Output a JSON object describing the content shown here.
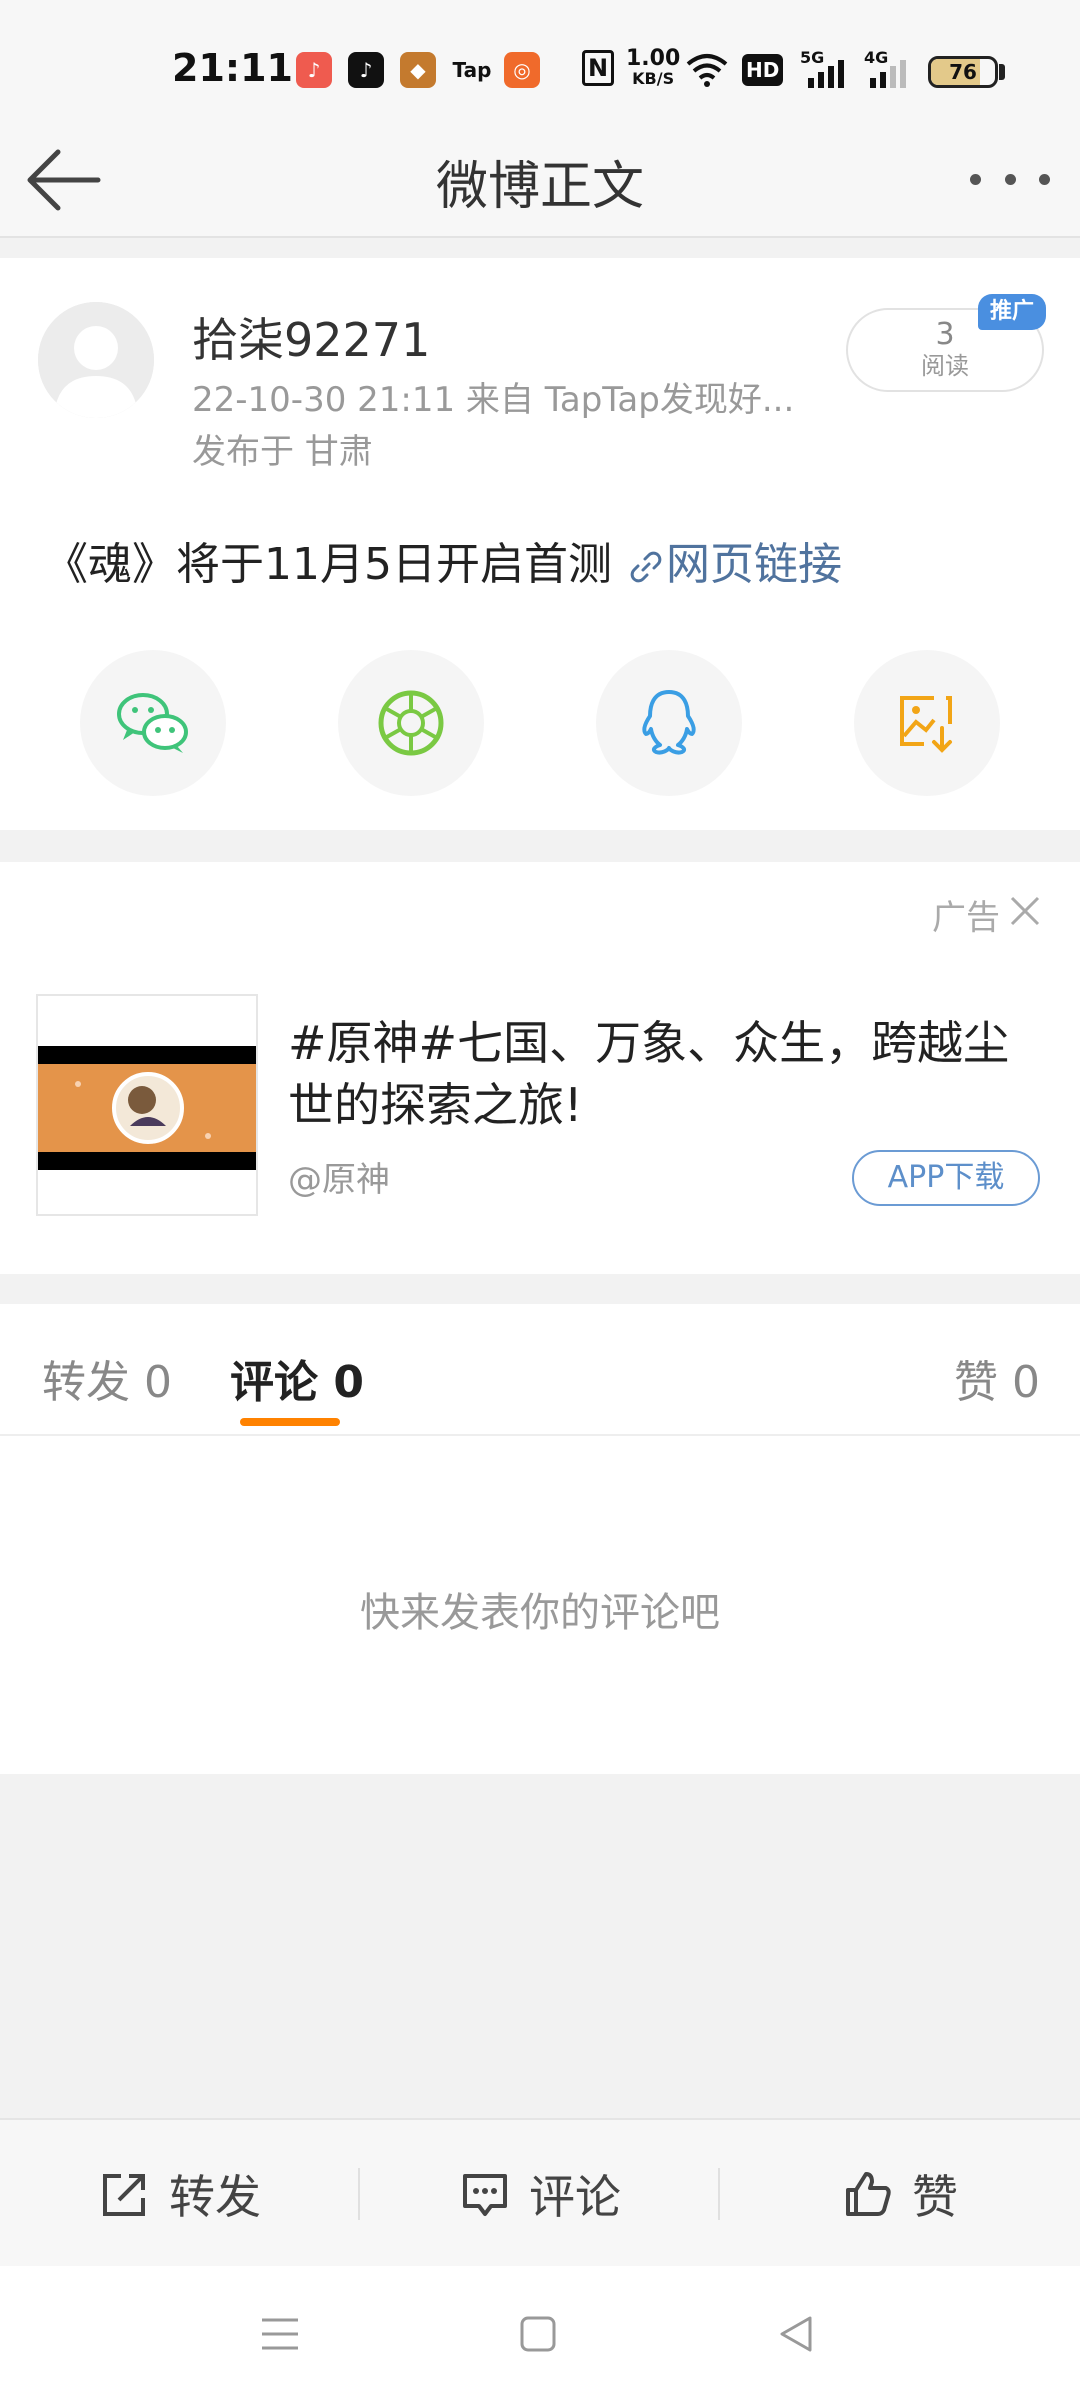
{
  "status_bar": {
    "time": "21:11",
    "apps": [
      {
        "icon": "music-app-icon",
        "color": "#ef5b4f"
      },
      {
        "icon": "tiktok-app-icon",
        "color": "#111111"
      },
      {
        "icon": "game-app-icon",
        "color": "#c47a2e"
      },
      {
        "icon": "taptap-app-icon",
        "text": "Tap"
      },
      {
        "icon": "store-app-icon",
        "color": "#f06a2b"
      }
    ],
    "nfc_label": "N",
    "net_speed": "1.00",
    "net_unit": "KB/S",
    "hd_label": "HD",
    "sim1_label": "5G",
    "sim2_label": "4G",
    "battery": "76",
    "battery_level": 0.76
  },
  "nav": {
    "title": "微博正文"
  },
  "post": {
    "username": "拾柒92271",
    "meta": "22-10-30 21:11   来自 TapTap发现好...",
    "location": "发布于 甘肃",
    "read_count": "3",
    "read_label": "阅读",
    "promo_tag": "推广",
    "text": "《魂》将于11月5日开启首测 ",
    "link_text": "网页链接",
    "share": [
      {
        "icon": "wechat-icon",
        "color": "#3fc47a"
      },
      {
        "icon": "moments-icon",
        "color": "#7ac943"
      },
      {
        "icon": "qq-icon",
        "color": "#3a9ee4"
      },
      {
        "icon": "save-image-icon",
        "color": "#f2a516"
      }
    ]
  },
  "ad": {
    "label": "广告",
    "title": "#原神#七国、万象、众生，跨越尘世的探索之旅!",
    "handle": "@原神",
    "download_label": "APP下载"
  },
  "tabs": {
    "repost": "转发 0",
    "comment": "评论 0",
    "like": "赞 0",
    "active_color": "#ff8200",
    "empty_text": "快来发表你的评论吧"
  },
  "toolbar": {
    "repost": "转发",
    "comment": "评论",
    "like": "赞"
  }
}
